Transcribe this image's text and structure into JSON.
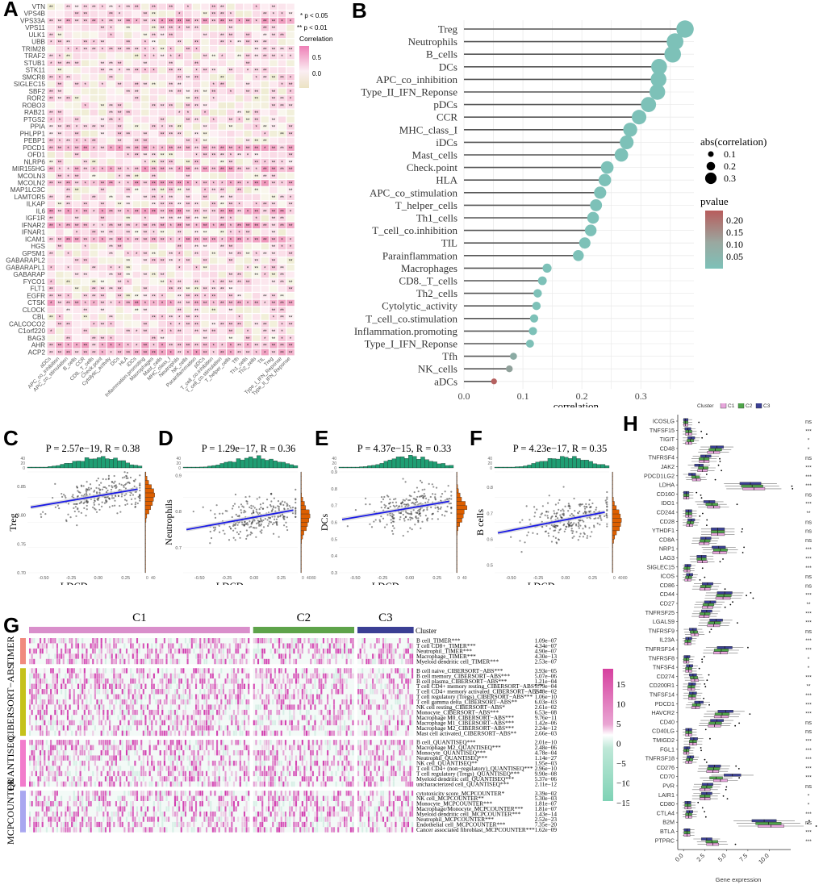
{
  "panels": {
    "A": "A",
    "B": "B",
    "C": "C",
    "D": "D",
    "E": "E",
    "F": "F",
    "G": "G",
    "H": "H"
  },
  "chart_data": [
    {
      "id": "A",
      "type": "heatmap",
      "title": "",
      "legend": {
        "sig1": "* p < 0.05",
        "sig2": "** p < 0.01",
        "title": "Correlation",
        "ticks": [
          "0.5",
          "0.0"
        ],
        "range": [
          -0.1,
          0.7
        ]
      },
      "rows": [
        "VTN",
        "VPS4B",
        "VPS33A",
        "VPS11",
        "ULK1",
        "UBB",
        "TRIM28",
        "TRAF2",
        "STUB1",
        "STK11",
        "SMCR8",
        "SIGLEC15",
        "SBF2",
        "ROR2",
        "ROBO3",
        "RAB21",
        "PTGS2",
        "PPIA",
        "PHLPP1",
        "PEBP1",
        "PDCD1",
        "OFD1",
        "NLRP6",
        "MIR155HG",
        "MCOLN3",
        "MCOLN2",
        "MAP1LC3C",
        "LAMTOR5",
        "ILKAP",
        "IL6",
        "IGF1R",
        "IFNAR2",
        "IFNAR1",
        "ICAM1",
        "HGS",
        "GPSM1",
        "GABARAPL2",
        "GABARAPL1",
        "GABARAP",
        "FYCO1",
        "FLT1",
        "EGFR",
        "CTSK",
        "CLOCK",
        "CBL",
        "CALCOCO2",
        "C1orf220",
        "BAG3",
        "AHR",
        "ACP2"
      ],
      "columns": [
        "aDCs",
        "APC_co_inhibition",
        "APC_co_stimulation",
        "B_cells",
        "CCR",
        "CD8._T_cells",
        "Check.point",
        "Cytolytic_activity",
        "DCs",
        "HLA",
        "iDCs",
        "Inflammation.promoting",
        "Macrophages",
        "Mast_cells",
        "MHC_class_I",
        "Neutrophils",
        "NK_cells",
        "Parainflammation",
        "pDCs",
        "T_cell_co.inhibition",
        "T_cell_co.stimulation",
        "T_helper_cells",
        "Tfh",
        "Th1_cells",
        "Th2_cells",
        "TIL",
        "Treg",
        "Type_I_IFN_Reponse",
        "Type_II_IFN_Reponse"
      ],
      "strong_rows": [
        "VPS33A",
        "PDCD1",
        "MIR155HG",
        "MCOLN2",
        "IFNAR2",
        "ICAM1",
        "AHR",
        "ACP2",
        "IL6",
        "CTSK"
      ],
      "note": "cell-level correlation values and significance stars shown as pink/beige tiles"
    },
    {
      "id": "B",
      "type": "scatter",
      "subtype": "lollipop",
      "xlabel": "correlation",
      "xlim": [
        0,
        0.39
      ],
      "xticks": [
        "0.0",
        "0.1",
        "0.2",
        "0.3"
      ],
      "size_legend": {
        "title": "abs(correlation)",
        "values": [
          "0.1",
          "0.2",
          "0.3"
        ]
      },
      "color_legend": {
        "title": "pvalue",
        "ticks": [
          "0.20",
          "0.15",
          "0.10",
          "0.05"
        ],
        "low": "#7dc1b8",
        "high": "#b85c5c"
      },
      "categories": [
        "Treg",
        "Neutrophils",
        "B_cells",
        "DCs",
        "APC_co_inhibition",
        "Type_II_IFN_Reponse",
        "pDCs",
        "CCR",
        "MHC_class_I",
        "iDCs",
        "Mast_cells",
        "Check.point",
        "HLA",
        "APC_co_stimulation",
        "T_helper_cells",
        "Th1_cells",
        "T_cell_co.inhibition",
        "TIL",
        "Parainflammation",
        "Macrophages",
        "CD8._T_cells",
        "Th2_cells",
        "Cytolytic_activity",
        "T_cell_co.stimulation",
        "Inflammation.promoting",
        "Type_I_IFN_Reponse",
        "Tfh",
        "NK_cells",
        "aDCs"
      ],
      "values": [
        0.375,
        0.358,
        0.354,
        0.331,
        0.33,
        0.328,
        0.313,
        0.297,
        0.282,
        0.276,
        0.267,
        0.243,
        0.239,
        0.231,
        0.224,
        0.219,
        0.215,
        0.205,
        0.194,
        0.141,
        0.133,
        0.125,
        0.123,
        0.119,
        0.117,
        0.112,
        0.084,
        0.077,
        0.051
      ],
      "pvalues": [
        0.001,
        0.001,
        0.001,
        0.001,
        0.001,
        0.001,
        0.001,
        0.001,
        0.001,
        0.001,
        0.001,
        0.001,
        0.001,
        0.001,
        0.001,
        0.001,
        0.001,
        0.001,
        0.001,
        0.003,
        0.005,
        0.008,
        0.009,
        0.01,
        0.011,
        0.013,
        0.06,
        0.08,
        0.22
      ]
    },
    {
      "id": "C",
      "type": "scatter",
      "title": "P = 2.57e−19, R = 0.38",
      "xlabel": "LDCD scores",
      "ylabel": "Treg",
      "xlim": [
        -0.65,
        0.4
      ],
      "ylim": [
        0.7,
        0.875
      ],
      "xticks": [
        "-0.50",
        "-0.25",
        "0.00",
        "0.25"
      ],
      "yticks": [
        "0.70",
        "0.75",
        "0.80",
        "0.85"
      ],
      "fit": {
        "slope": 0.032,
        "intercept": 0.8335
      },
      "margin_ticks": [
        "0",
        "40"
      ],
      "hist_ticks": [
        "0",
        "20",
        "40"
      ]
    },
    {
      "id": "D",
      "type": "scatter",
      "title": "P = 1.29e−17, R = 0.36",
      "xlabel": "LDCD scores",
      "ylabel": "Neutrophils",
      "xlim": [
        -0.65,
        0.4
      ],
      "ylim": [
        0.63,
        0.91
      ],
      "xticks": [
        "-0.50",
        "-0.25",
        "0.00",
        "0.25"
      ],
      "yticks": [
        "0.7",
        "0.8",
        "0.9"
      ],
      "fit": {
        "slope": 0.055,
        "intercept": 0.784
      },
      "margin_ticks": [
        "0",
        "40",
        "80"
      ],
      "hist_ticks": [
        "0",
        "20",
        "40"
      ]
    },
    {
      "id": "E",
      "type": "scatter",
      "title": "P = 4.37e−15, R = 0.33",
      "xlabel": "LDCD scores",
      "ylabel": "DCs",
      "xlim": [
        -0.65,
        0.4
      ],
      "ylim": [
        0.3,
        0.9
      ],
      "xticks": [
        "-0.50",
        "-0.25",
        "0.00",
        "0.25"
      ],
      "yticks": [
        "0.3",
        "0.4",
        "0.5",
        "0.6",
        "0.7",
        "0.8",
        "0.9"
      ],
      "fit": {
        "slope": 0.11,
        "intercept": 0.685
      },
      "margin_ticks": [
        "0",
        "40"
      ],
      "hist_ticks": [
        "0",
        "20",
        "40"
      ]
    },
    {
      "id": "F",
      "type": "scatter",
      "title": "P = 4.23e−17, R = 0.35",
      "xlabel": "LDCD scores",
      "ylabel": "B cells",
      "xlim": [
        -0.65,
        0.4
      ],
      "ylim": [
        0.47,
        0.86
      ],
      "xticks": [
        "-0.50",
        "-0.25",
        "0.00",
        "0.25"
      ],
      "yticks": [
        "0.5",
        "0.6",
        "0.7",
        "0.8"
      ],
      "fit": {
        "slope": 0.082,
        "intercept": 0.675
      },
      "margin_ticks": [
        "0",
        "40",
        "80"
      ],
      "hist_ticks": [
        "0",
        "20",
        "40"
      ]
    },
    {
      "id": "G",
      "type": "heatmap",
      "clusters": [
        {
          "name": "C1",
          "color": "#d98fcb",
          "frac": 0.59
        },
        {
          "name": "C2",
          "color": "#5ea34a",
          "frac": 0.27
        },
        {
          "name": "C3",
          "color": "#3b3f94",
          "frac": 0.15
        }
      ],
      "cluster_label": "Cluster",
      "colorbar": {
        "ticks": [
          "15",
          "10",
          "5",
          "0",
          "−5",
          "−10",
          "−15"
        ],
        "high": "#d6409f",
        "mid": "#ffffff",
        "low": "#7fd2b5"
      },
      "groups": [
        {
          "name": "TIMER",
          "color": "#f08a7e",
          "rows": [
            [
              "B cell_TIMER***",
              "1.09e−07"
            ],
            [
              "T cell CD8+_TIMER***",
              "4.34e−07"
            ],
            [
              "Neutrophil_TIMER***",
              "4.90e−07"
            ],
            [
              "Macrophage_TIMER***",
              "4.30e−13"
            ],
            [
              "Myeloid dendritic cell_TIMER***",
              "2.53e−07"
            ]
          ]
        },
        {
          "name": "CIBERSORT−ABS",
          "color": "#c5c21a",
          "rows": [
            [
              "B cell naive_CIBERSORT−ABS***",
              "3.93e−05"
            ],
            [
              "B cell memory_CIBERSORT−ABS***",
              "5.07e−06"
            ],
            [
              "B cell plasma_CIBERSORT−ABS***",
              "1.21e−04"
            ],
            [
              "T cell CD4+ memory resting_CIBERSORT−ABS***",
              "5.79e−04"
            ],
            [
              "T cell CD4+ memory activated_CIBERSORT−ABS*",
              "2.48e−02"
            ],
            [
              "T cell regulatory (Tregs)_CIBERSORT−ABS***",
              "1.06e−10"
            ],
            [
              "T cell gamma delta_CIBERSORT−ABS**",
              "6.03e−03"
            ],
            [
              "NK cell resting_CIBERSORT−ABS*",
              "2.61e−02"
            ],
            [
              "Monocyte_CIBERSORT−ABS***",
              "6.53e−08"
            ],
            [
              "Macrophage M0_CIBERSORT−ABS***",
              "9.76e−11"
            ],
            [
              "Macrophage M1_CIBERSORT−ABS***",
              "1.42e−06"
            ],
            [
              "Macrophage M2_CIBERSORT−ABS***",
              "2.24e−12"
            ],
            [
              "Mast cell activated_CIBERSORT−ABS**",
              "2.66e−03"
            ]
          ]
        },
        {
          "name": "QUANTISEQ",
          "color": "#f27ccc",
          "rows": [
            [
              "B cell_QUANTISEQ***",
              "2.01e−10"
            ],
            [
              "Macrophage M2_QUANTISEQ***",
              "2.48e−06"
            ],
            [
              "Monocyte_QUANTISEQ***",
              "4.78e−04"
            ],
            [
              "Neutrophil_QUANTISEQ***",
              "1.14e−27"
            ],
            [
              "NK cell_QUANTISEQ**",
              "1.95e−03"
            ],
            [
              "T cell CD4+ (non−regulatory)_QUANTISEQ***",
              "2.96e−10"
            ],
            [
              "T cell regulatory (Tregs)_QUANTISEQ***",
              "9.90e−08"
            ],
            [
              "Myeloid dendritic cell_QUANTISEQ***",
              "5.37e−06"
            ],
            [
              "uncharacterized cell_QUANTISEQ***",
              "2.11e−12"
            ]
          ]
        },
        {
          "name": "MCPCOUNTER",
          "color": "#a9a7f0",
          "rows": [
            [
              "cytotoxicity score_MCPCOUNTER*",
              "3.39e−02"
            ],
            [
              "NK cell_MCPCOUNTER**",
              "5.30e−03"
            ],
            [
              "Monocyte_MCPCOUNTER***",
              "1.81e−07"
            ],
            [
              "Macrophage/Monocyte_MCPCOUNTER***",
              "1.81e−07"
            ],
            [
              "Myeloid dendritic cell_MCPCOUNTER***",
              "1.43e−14"
            ],
            [
              "Neutrophil_MCPCOUNTER***",
              "2.52e−23"
            ],
            [
              "Endothelial cell_MCPCOUNTER***",
              "7.35e−20"
            ],
            [
              "Cancer associated fibroblast_MCPCOUNTER***",
              "1.62e−09"
            ]
          ]
        }
      ]
    },
    {
      "id": "H",
      "type": "bar",
      "subtype": "boxplot",
      "xlabel": "Gene expression",
      "xlim": [
        -0.3,
        12.5
      ],
      "xticks": [
        "0.0",
        "2.5",
        "5.0",
        "7.5",
        "10.0"
      ],
      "legend": {
        "title": "Cluster",
        "items": [
          {
            "name": "C1",
            "color": "#e7a6dc"
          },
          {
            "name": "C2",
            "color": "#4fa64a"
          },
          {
            "name": "C3",
            "color": "#3a3f94"
          }
        ]
      },
      "genes": [
        "ICOSLG",
        "TNFSF15",
        "TIGIT",
        "CD48",
        "TNFRSF4",
        "JAK2",
        "PDCD1LG2",
        "LDHA",
        "CD160",
        "IDO1",
        "CD244",
        "CD28",
        "YTHDF1",
        "CD8A",
        "NRP1",
        "LAG3",
        "SIGLEC15",
        "ICOS",
        "CD86",
        "CD44",
        "CD27",
        "TNFRSF25",
        "LGALS9",
        "TNFRSF9",
        "IL23A",
        "TNFRSF14",
        "TNFRSF8",
        "TNFSF4",
        "CD274",
        "CD200R1",
        "TNFSF14",
        "PDCD1",
        "HAVCR2",
        "CD40",
        "CD40LG",
        "TMIGD2",
        "FGL1",
        "TNFRSF18",
        "CD276",
        "CD70",
        "PVR",
        "LAIR1",
        "CD80",
        "CTLA4",
        "B2M",
        "BTLA",
        "PTPRC"
      ],
      "significance": [
        "ns",
        "***",
        "*",
        "*",
        "ns",
        "***",
        "***",
        "***",
        "ns",
        "***",
        "**",
        "ns",
        "ns",
        "ns",
        "***",
        "***",
        "***",
        "ns",
        "ns",
        "***",
        "**",
        "***",
        "***",
        "ns",
        "***",
        "***",
        "*",
        "*",
        "***",
        "**",
        "***",
        "***",
        "***",
        "ns",
        "ns",
        "***",
        "***",
        "***",
        "***",
        "***",
        "ns",
        "*",
        "*",
        "***",
        "ns",
        "***",
        "***"
      ],
      "medians": {
        "C1": [
          0.2,
          0.6,
          0.6,
          3.5,
          2.4,
          2.2,
          1.5,
          8.2,
          0.3,
          3.5,
          0.6,
          0.7,
          4.0,
          2.4,
          4.2,
          2.2,
          0.4,
          0.5,
          2.5,
          4.6,
          2.8,
          2.4,
          3.5,
          1.3,
          0.5,
          4.3,
          0.3,
          0.6,
          1.3,
          0.9,
          1.0,
          1.4,
          4.4,
          3.6,
          0.6,
          1.1,
          0.3,
          0.6,
          3.4,
          4.3,
          2.5,
          2.5,
          0.5,
          0.6,
          10.2,
          0.4,
          3.4
        ],
        "C2": [
          0.2,
          0.6,
          0.8,
          3.7,
          2.4,
          2.3,
          1.4,
          8.0,
          0.3,
          3.3,
          0.6,
          0.8,
          4.0,
          2.5,
          4.3,
          2.1,
          0.4,
          0.6,
          2.6,
          4.7,
          2.9,
          2.5,
          3.6,
          1.2,
          0.5,
          4.4,
          0.3,
          0.6,
          1.2,
          0.9,
          1.0,
          1.5,
          4.5,
          3.7,
          0.6,
          1.1,
          0.3,
          0.7,
          3.5,
          3.8,
          2.7,
          2.5,
          0.5,
          0.6,
          9.9,
          0.4,
          3.3
        ],
        "C3": [
          0.2,
          0.5,
          0.9,
          3.9,
          2.6,
          1.8,
          1.0,
          7.8,
          0.3,
          3.0,
          0.6,
          0.9,
          4.0,
          2.6,
          4.1,
          2.1,
          0.5,
          0.7,
          2.8,
          4.8,
          3.1,
          2.7,
          3.8,
          1.1,
          0.6,
          4.8,
          0.4,
          0.7,
          1.1,
          1.0,
          1.1,
          1.8,
          4.9,
          3.9,
          0.6,
          1.2,
          0.4,
          0.8,
          3.6,
          5.7,
          2.8,
          2.7,
          0.5,
          0.7,
          9.4,
          0.4,
          2.7
        ]
      }
    }
  ]
}
